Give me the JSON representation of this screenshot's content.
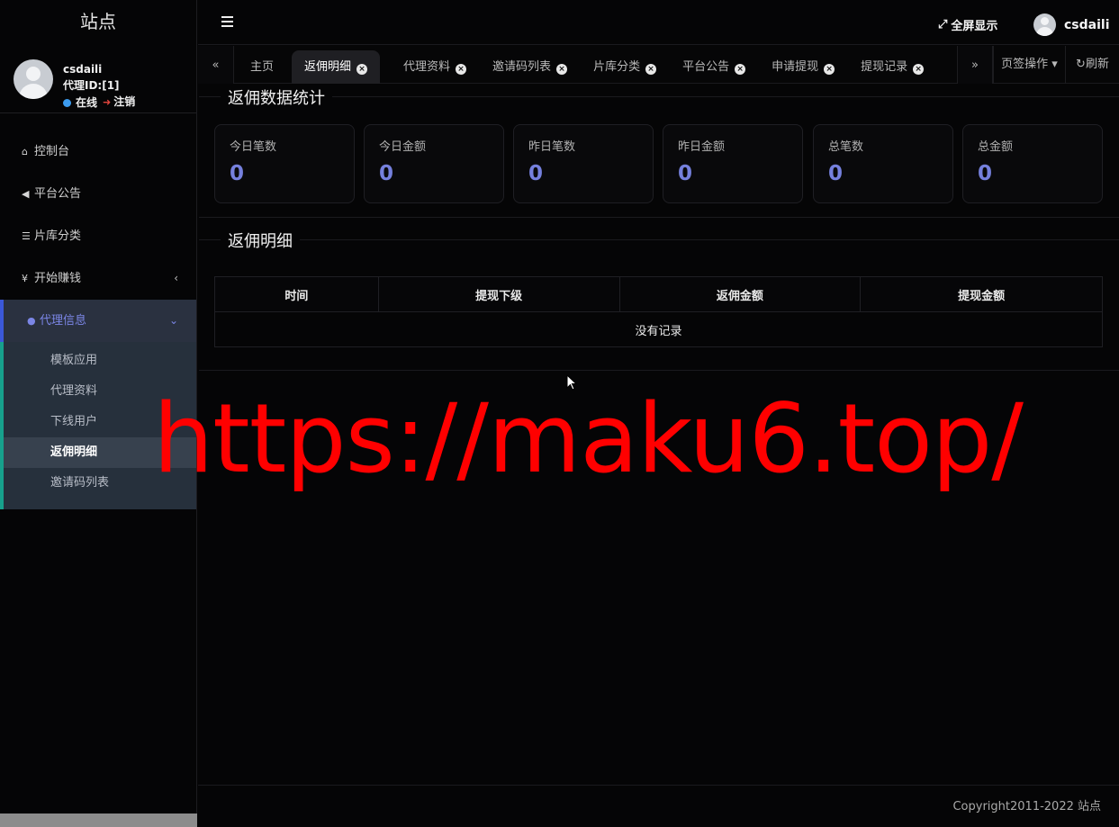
{
  "sidebar": {
    "site_title": "站点",
    "user": {
      "name": "csdaili",
      "agent_id": "代理ID:[1]",
      "status": "在线",
      "logout": "注销"
    },
    "menu": [
      {
        "icon": "home-icon",
        "label": "控制台"
      },
      {
        "icon": "bullhorn-icon",
        "label": "平台公告"
      },
      {
        "icon": "list-icon",
        "label": "片库分类"
      },
      {
        "icon": "yen-icon",
        "label": "开始赚钱",
        "arrow": "‹"
      },
      {
        "icon": "user-icon",
        "label": "代理信息",
        "arrow": "⌄",
        "active": true
      }
    ],
    "submenu": [
      {
        "label": "模板应用"
      },
      {
        "label": "代理资料"
      },
      {
        "label": "下线用户"
      },
      {
        "label": "返佣明细",
        "current": true
      },
      {
        "label": "邀请码列表"
      }
    ]
  },
  "header": {
    "fullscreen": "全屏显示",
    "username": "csdaili"
  },
  "tabs": {
    "items": [
      {
        "label": "主页",
        "closable": false
      },
      {
        "label": "返佣明细",
        "closable": true,
        "active": true
      },
      {
        "label": "代理资料",
        "closable": true
      },
      {
        "label": "邀请码列表",
        "closable": true
      },
      {
        "label": "片库分类",
        "closable": true
      },
      {
        "label": "平台公告",
        "closable": true
      },
      {
        "label": "申请提现",
        "closable": true
      },
      {
        "label": "提现记录",
        "closable": true
      }
    ],
    "ops": "页签操作",
    "refresh": "刷新"
  },
  "stats": {
    "title": "返佣数据统计",
    "cards": [
      {
        "label": "今日笔数",
        "value": "0"
      },
      {
        "label": "今日金额",
        "value": "0"
      },
      {
        "label": "昨日笔数",
        "value": "0"
      },
      {
        "label": "昨日金额",
        "value": "0"
      },
      {
        "label": "总笔数",
        "value": "0"
      },
      {
        "label": "总金额",
        "value": "0"
      }
    ]
  },
  "detail": {
    "title": "返佣明细",
    "columns": [
      "时间",
      "提现下级",
      "返佣金额",
      "提现金额"
    ],
    "empty": "没有记录"
  },
  "footer": {
    "copyright": "Copyright2011-2022 站点"
  },
  "watermark": "https://maku6.top/",
  "colors": {
    "accent": "#7580dd",
    "active_menu_bg": "#2a3140",
    "watermark": "#ff0000"
  }
}
